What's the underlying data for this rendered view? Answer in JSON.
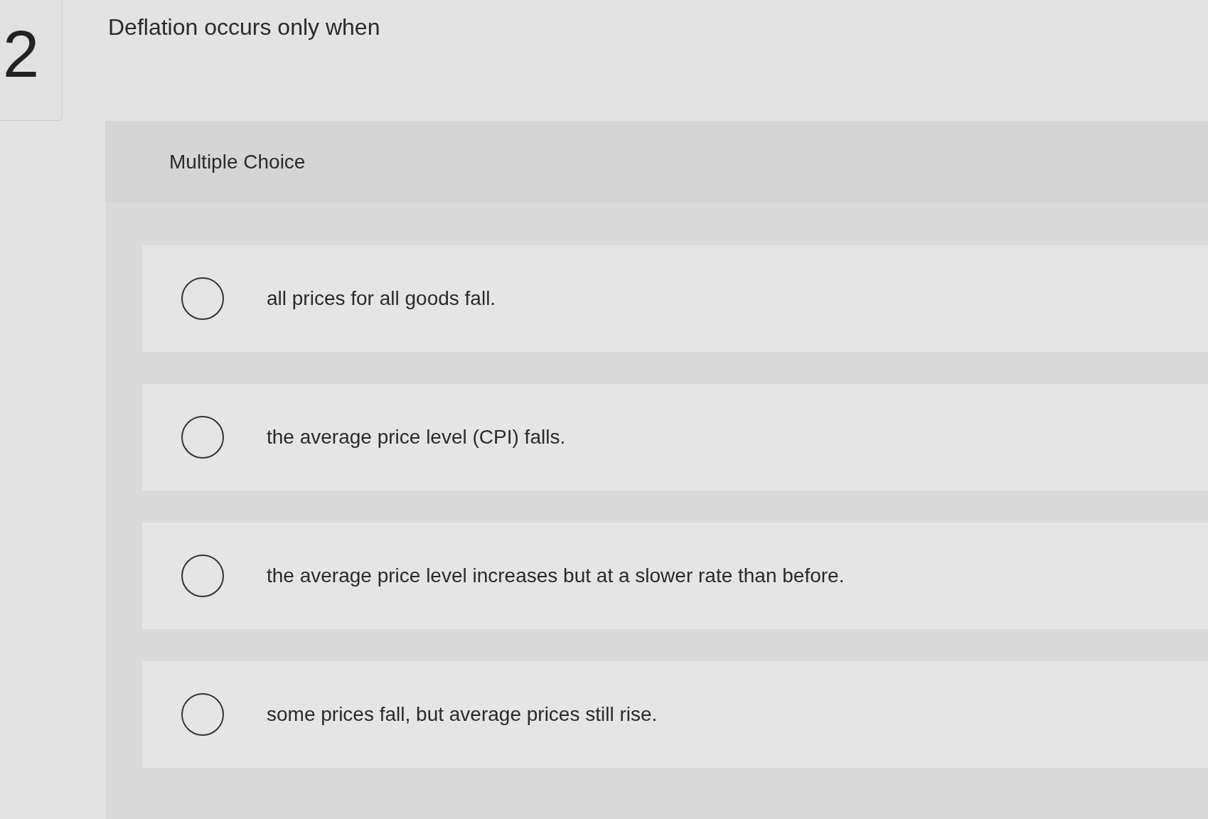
{
  "question_number": "2",
  "question": "Deflation occurs only when",
  "question_type": "Multiple Choice",
  "options": [
    {
      "label": "all prices for all goods fall.",
      "selected": false
    },
    {
      "label": "the average price level (CPI) falls.",
      "selected": false
    },
    {
      "label": "the average price level increases but at a slower rate than before.",
      "selected": false
    },
    {
      "label": "some prices fall, but average prices still rise.",
      "selected": false
    }
  ]
}
